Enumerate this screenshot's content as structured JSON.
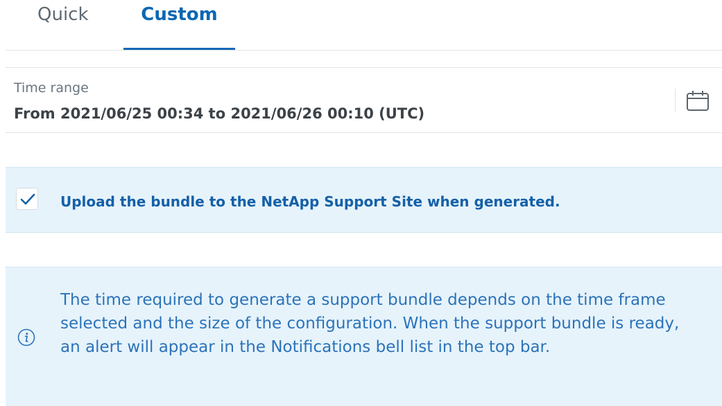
{
  "tabs": {
    "quick": "Quick",
    "custom": "Custom",
    "active": "Custom"
  },
  "time_range": {
    "label": "Time range",
    "value": "From 2021/06/25 00:34 to 2021/06/26 00:10 (UTC)",
    "icon": "calendar-icon"
  },
  "upload": {
    "checked": true,
    "label": "Upload the bundle to the NetApp Support Site when generated."
  },
  "info": {
    "icon": "info-icon",
    "text": "The time required to generate a support bundle depends on the time frame selected and the size of the configuration. When the support bundle is ready, an alert will appear in the Notifications bell list in the top bar."
  },
  "colors": {
    "accent": "#1667b7",
    "banner_bg": "#e6f3fb",
    "info_text": "#2c73b9"
  }
}
